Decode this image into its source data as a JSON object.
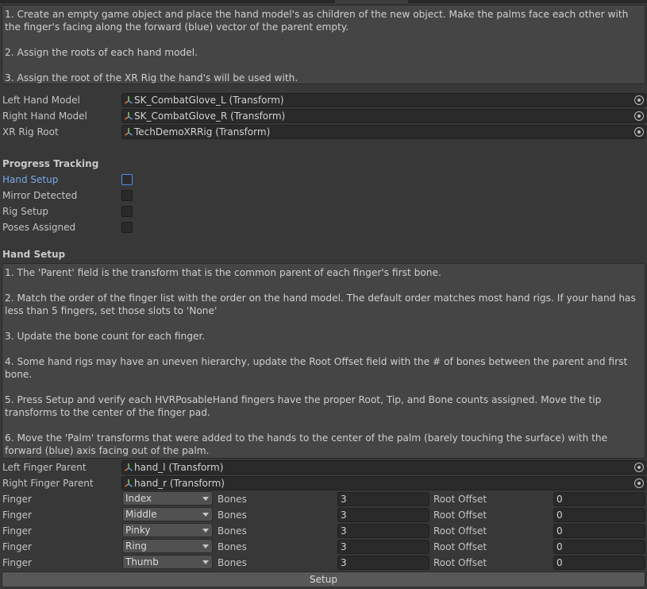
{
  "instructions1": [
    "1. Create an empty game object and place the hand model's as children of the new object. Make the palms face each other with the finger's facing along the forward (blue) vector of the parent empty.",
    "2. Assign the roots of each hand model.",
    "3. Assign the root of the XR Rig the hand's will be used with."
  ],
  "models": [
    {
      "label": "Left Hand Model",
      "value": "SK_CombatGlove_L (Transform)"
    },
    {
      "label": "Right Hand Model",
      "value": "SK_CombatGlove_R (Transform)"
    },
    {
      "label": "XR Rig Root",
      "value": "TechDemoXRRig (Transform)"
    }
  ],
  "progress": {
    "title": "Progress Tracking",
    "items": [
      {
        "label": "Hand Setup",
        "checked": false,
        "active": true
      },
      {
        "label": "Mirror Detected",
        "checked": false
      },
      {
        "label": "Rig Setup",
        "checked": false
      },
      {
        "label": "Poses Assigned",
        "checked": false
      }
    ]
  },
  "hand_setup": {
    "title": "Hand Setup",
    "instructions": [
      "1. The 'Parent' field is the transform that is the common parent of each finger's first bone.",
      "2. Match the order of the finger list with the order on the hand model. The default order matches most hand rigs. If your hand has less than 5 fingers, set those slots to 'None'",
      "3. Update the bone count for each finger.",
      "4. Some hand rigs may have an uneven hierarchy, update the Root Offset field with the # of bones between the parent and first bone.",
      "5. Press Setup and verify each HVRPosableHand fingers have the proper Root, Tip, and Bone counts assigned. Move the tip transforms to the center of the finger pad.",
      "6. Move the 'Palm' transforms that were added to the hands to the center of the palm (barely touching the surface) with the forward (blue) axis facing out of the palm."
    ],
    "parents": [
      {
        "label": "Left Finger Parent",
        "value": "hand_l (Transform)"
      },
      {
        "label": "Right Finger Parent",
        "value": "hand_r (Transform)"
      }
    ],
    "finger_label": "Finger",
    "bones_label": "Bones",
    "offset_label": "Root Offset",
    "fingers": [
      {
        "name": "Index",
        "bones": "3",
        "offset": "0"
      },
      {
        "name": "Middle",
        "bones": "3",
        "offset": "0"
      },
      {
        "name": "Pinky",
        "bones": "3",
        "offset": "0"
      },
      {
        "name": "Ring",
        "bones": "3",
        "offset": "0"
      },
      {
        "name": "Thumb",
        "bones": "3",
        "offset": "0"
      }
    ],
    "setup_button": "Setup"
  },
  "colors": {
    "background": "#383838",
    "helpbox": "#454545",
    "field": "#2a2a2a",
    "accent": "#4d8ff0",
    "active_label": "#7aa9e8"
  }
}
